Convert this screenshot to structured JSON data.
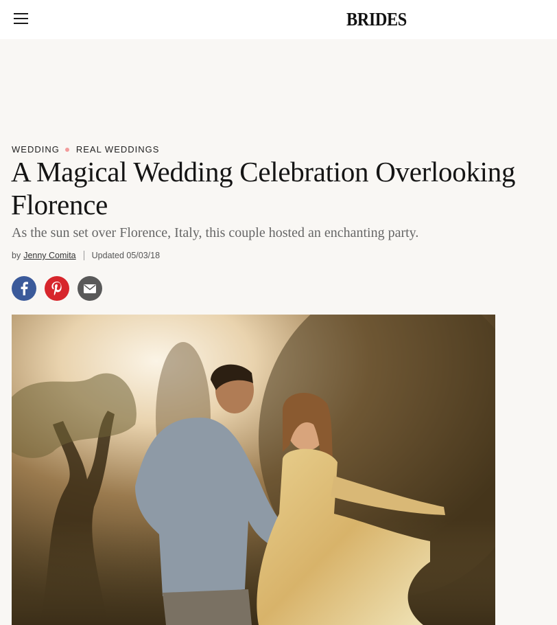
{
  "header": {
    "logo": "BRIDES",
    "menu_icon": "hamburger-menu-icon"
  },
  "breadcrumb": {
    "first": "WEDDING",
    "second": "REAL WEDDINGS",
    "dot_color": "#f29b9b"
  },
  "article": {
    "title": "A Magical Wedding Celebration Overlooking Florence",
    "subtitle": "As the sun set over Florence, Italy, this couple hosted an enchanting party.",
    "byline_prefix": "by",
    "author": "Jenny Comita",
    "updated": "Updated 05/03/18"
  },
  "share": {
    "icons": [
      "facebook-icon",
      "pinterest-icon",
      "email-icon"
    ],
    "colors": {
      "facebook": "#3b5a9a",
      "pinterest": "#d7262c",
      "email": "#595959"
    }
  },
  "hero_image": {
    "subject": "couple-dancing-at-sunset-photo"
  }
}
